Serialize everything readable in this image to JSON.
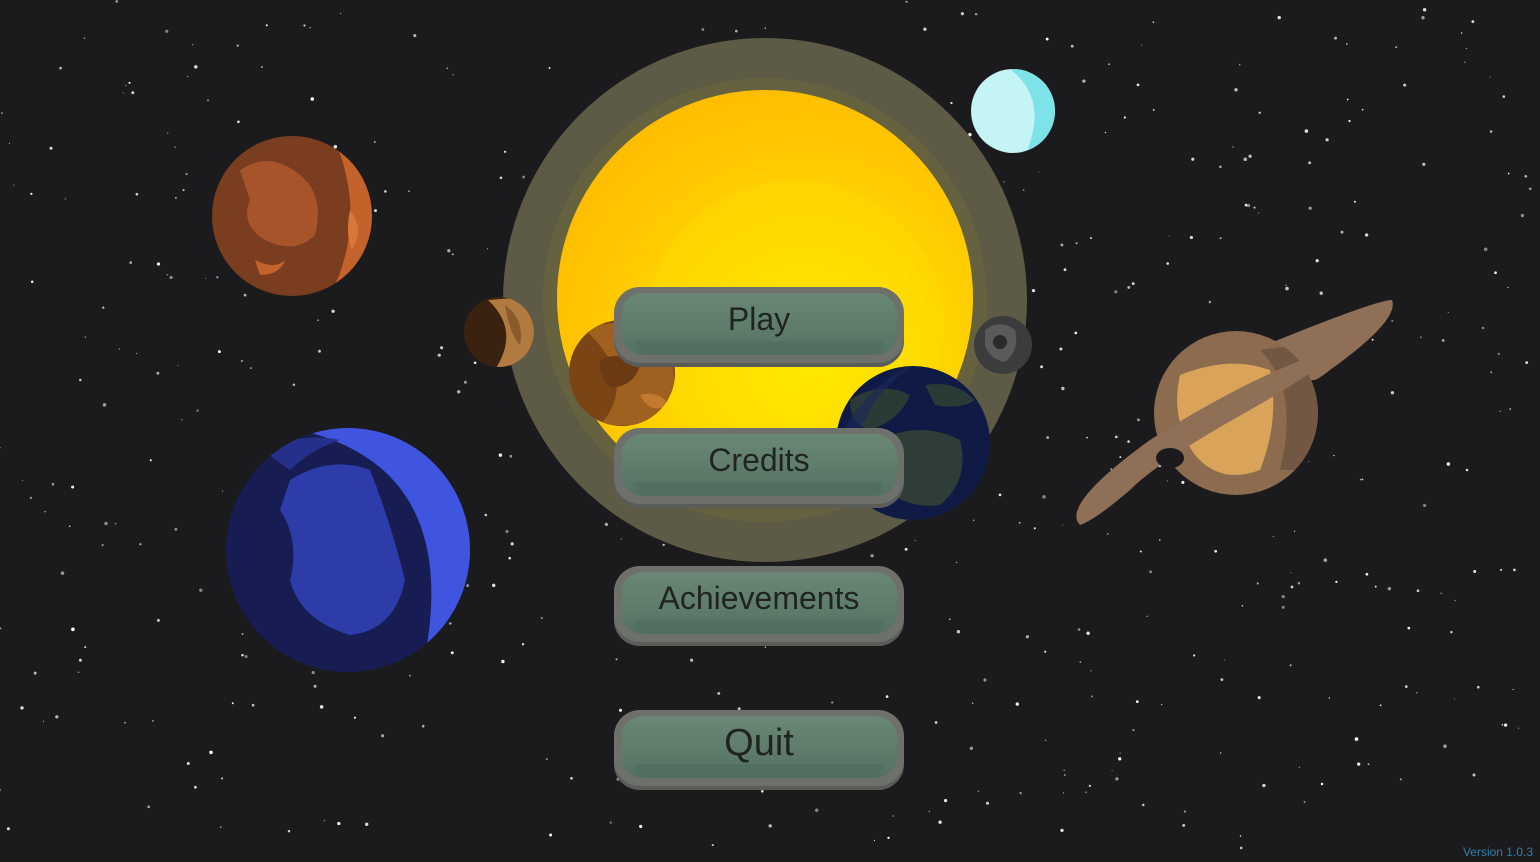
{
  "menu": {
    "play_label": "Play",
    "credits_label": "Credits",
    "achievements_label": "Achievements",
    "quit_label": "Quit"
  },
  "footer": {
    "version_label": "Version 1.0.3"
  },
  "colors": {
    "background": "#1b1b1e",
    "button_face": "#5f7c6b",
    "button_rim": "#6e706b",
    "version_text": "#2e7fa8"
  }
}
